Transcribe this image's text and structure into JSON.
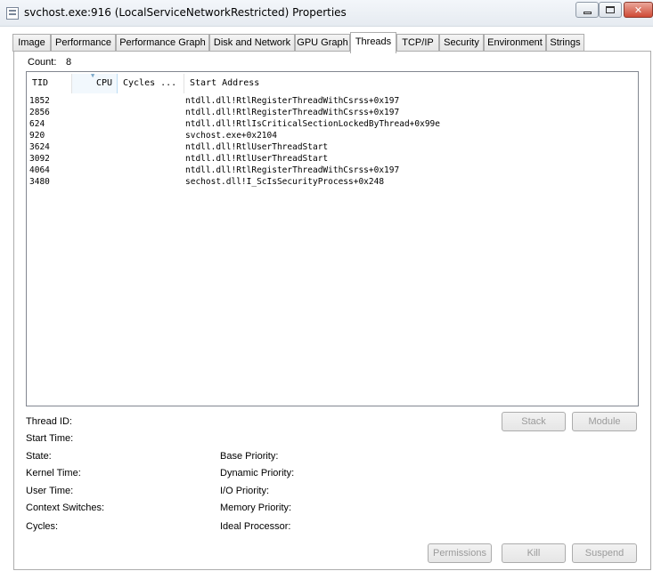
{
  "window": {
    "title": "svchost.exe:916 (LocalServiceNetworkRestricted) Properties",
    "minimize_glyph": "",
    "maximize_glyph": "",
    "close_glyph": "✕"
  },
  "tabs": [
    {
      "label": "Image"
    },
    {
      "label": "Performance"
    },
    {
      "label": "Performance Graph"
    },
    {
      "label": "Disk and Network"
    },
    {
      "label": "GPU Graph"
    },
    {
      "label": "Threads",
      "active": true
    },
    {
      "label": "TCP/IP"
    },
    {
      "label": "Security"
    },
    {
      "label": "Environment"
    },
    {
      "label": "Strings"
    }
  ],
  "threads": {
    "count_label": "Count:",
    "count_value": "8",
    "columns": [
      "TID",
      "CPU",
      "Cycles ...",
      "Start Address"
    ],
    "sorted_column": "CPU",
    "rows": [
      {
        "tid": "1852",
        "start_address": "ntdll.dll!RtlRegisterThreadWithCsrss+0x197"
      },
      {
        "tid": "2856",
        "start_address": "ntdll.dll!RtlRegisterThreadWithCsrss+0x197"
      },
      {
        "tid": "624",
        "start_address": "ntdll.dll!RtlIsCriticalSectionLockedByThread+0x99e"
      },
      {
        "tid": "920",
        "start_address": "svchost.exe+0x2104"
      },
      {
        "tid": "3624",
        "start_address": "ntdll.dll!RtlUserThreadStart"
      },
      {
        "tid": "3092",
        "start_address": "ntdll.dll!RtlUserThreadStart"
      },
      {
        "tid": "4064",
        "start_address": "ntdll.dll!RtlRegisterThreadWithCsrss+0x197"
      },
      {
        "tid": "3480",
        "start_address": "sechost.dll!I_ScIsSecurityProcess+0x248"
      }
    ]
  },
  "details": {
    "thread_id": "Thread ID:",
    "start_time": "Start Time:",
    "state": "State:",
    "kernel_time": "Kernel Time:",
    "user_time": "User Time:",
    "context_switches": "Context Switches:",
    "cycles": "Cycles:",
    "base_priority": "Base Priority:",
    "dynamic_priority": "Dynamic Priority:",
    "io_priority": "I/O Priority:",
    "memory_priority": "Memory Priority:",
    "ideal_processor": "Ideal Processor:"
  },
  "buttons": {
    "stack": "Stack",
    "module": "Module",
    "permissions": "Permissions",
    "kill": "Kill",
    "suspend": "Suspend"
  }
}
